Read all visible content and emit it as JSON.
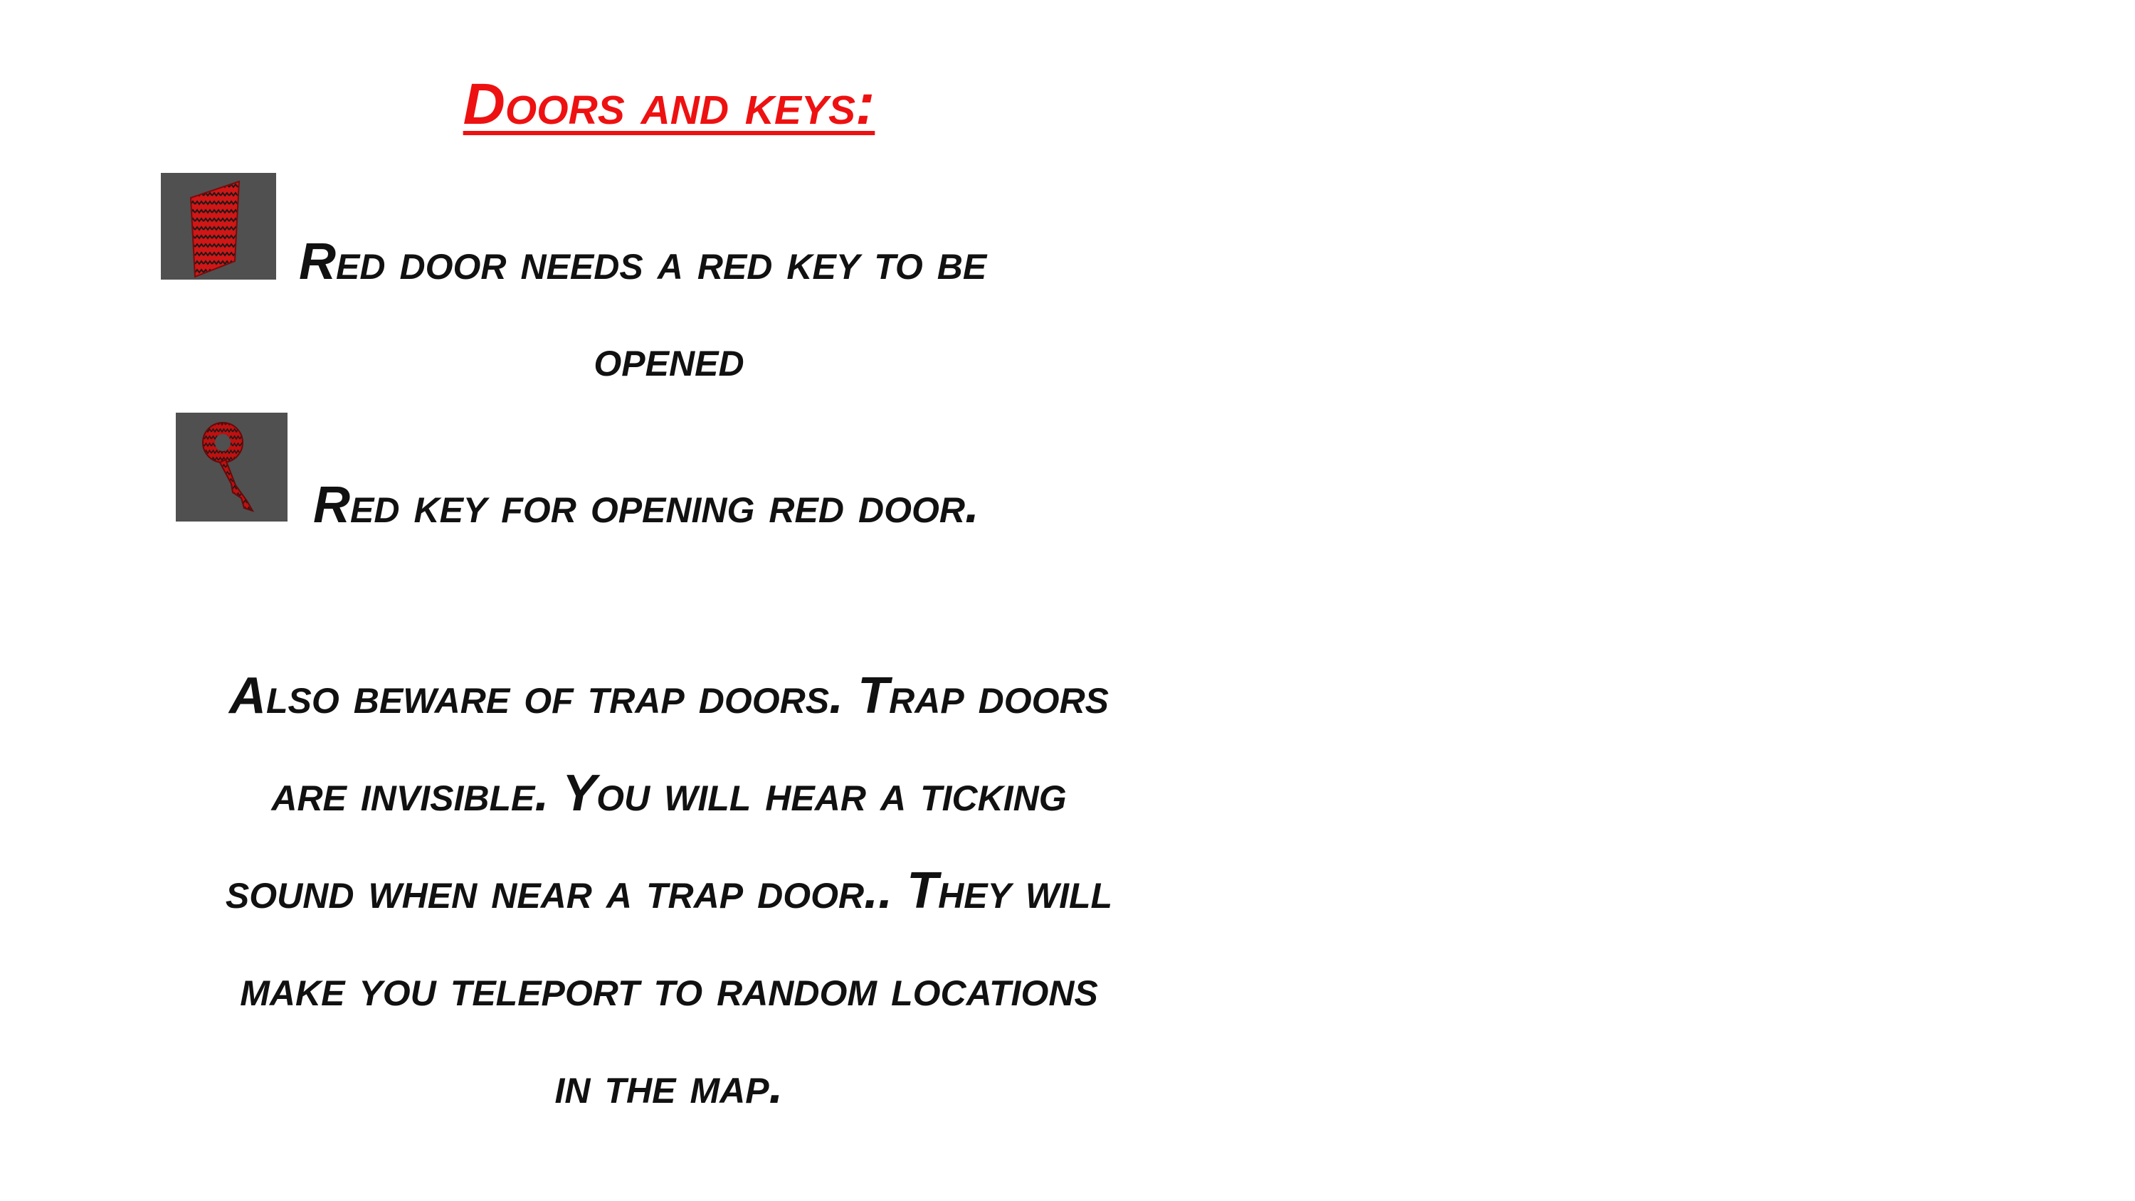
{
  "heading": "Doors and keys:",
  "items": [
    {
      "icon": "red-door-icon",
      "text_line1": "Red door needs a red key to be",
      "text_line2": "opened"
    },
    {
      "icon": "red-key-icon",
      "text_line1": "Red key for opening red door."
    }
  ],
  "warning_lines": [
    "Also beware of trap doors. Trap doors",
    "are invisible. You will hear a ticking",
    "sound when near a trap door.. They will",
    "make you teleport to random locations",
    "in the map."
  ],
  "colors": {
    "heading": "#ee1111",
    "text": "#111111",
    "tile_bg": "#505050",
    "door_red": "#d11616",
    "key_red": "#c01010"
  }
}
